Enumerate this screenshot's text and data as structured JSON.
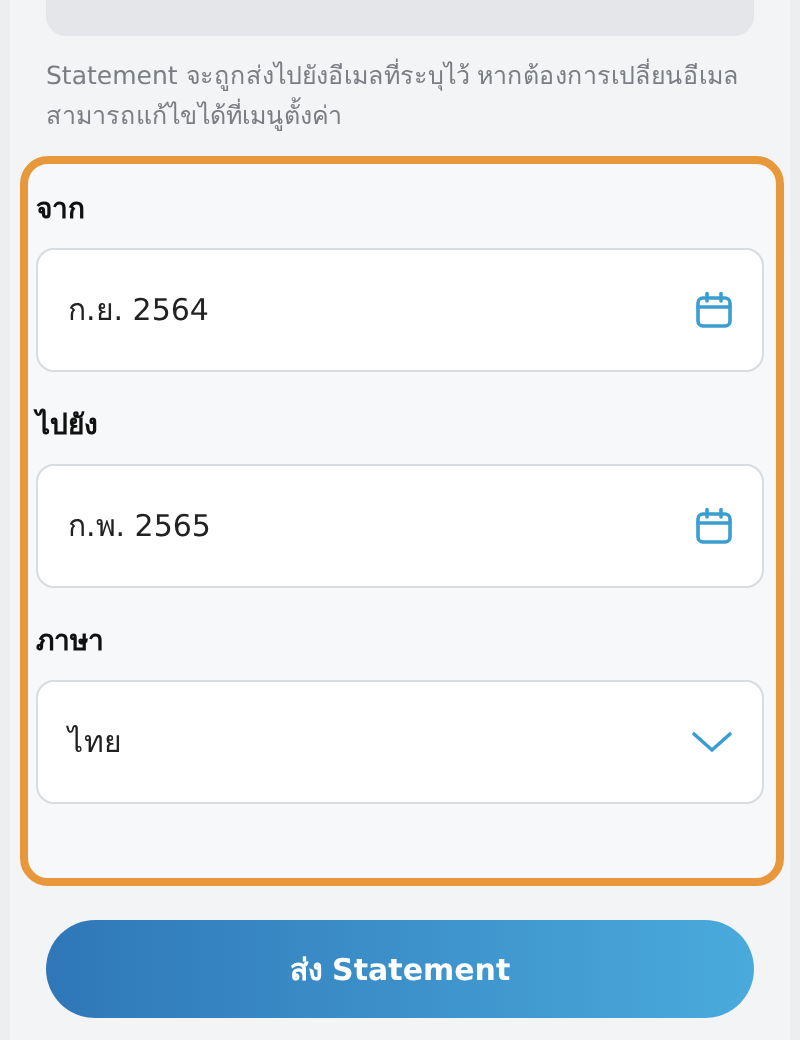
{
  "note": "Statement จะถูกส่งไปยังอีเมลที่ระบุไว้ หากต้องการเปลี่ยนอีเมล สามารถแก้ไขได้ที่เมนูตั้งค่า",
  "fields": [
    {
      "label": "จาก",
      "value": "ก.ย. 2564",
      "kind": "date"
    },
    {
      "label": "ไปยัง",
      "value": "ก.พ. 2565",
      "kind": "date"
    },
    {
      "label": "ภาษา",
      "value": "ไทย",
      "kind": "select"
    }
  ],
  "highlighted": true,
  "button": "ส่ง Statement"
}
